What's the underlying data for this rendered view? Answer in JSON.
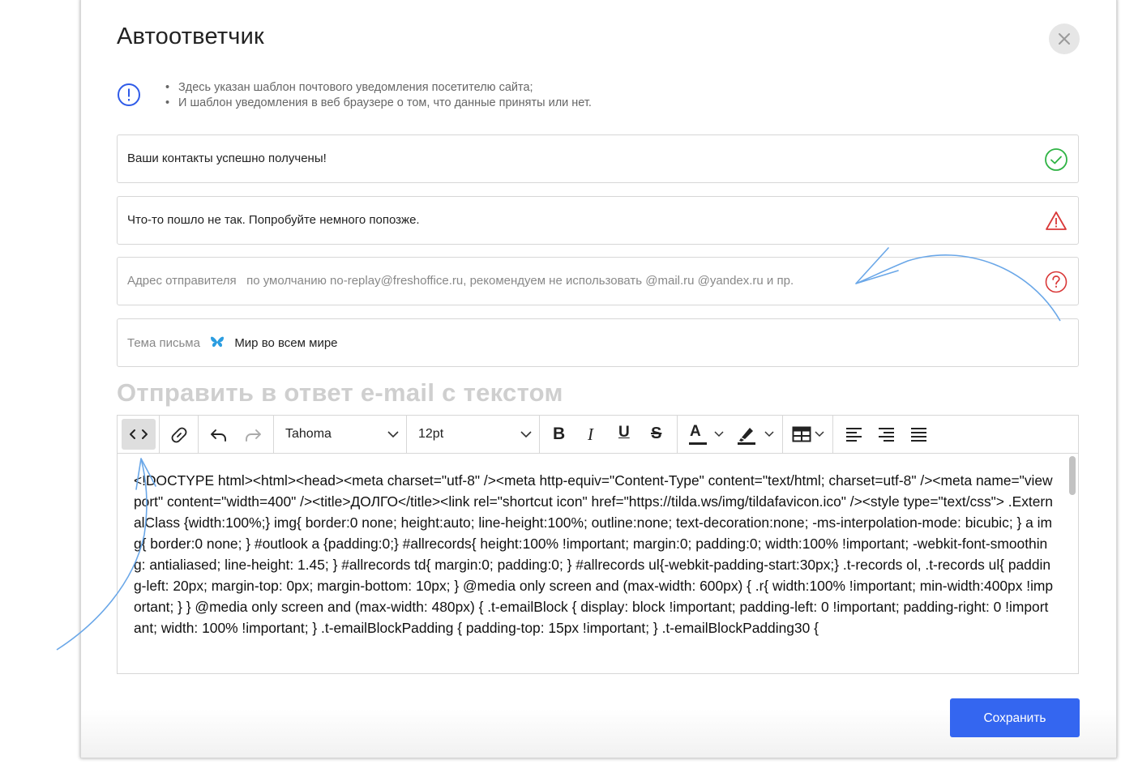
{
  "dialog": {
    "title": "Автоответчик",
    "info": [
      "Здесь указан шаблон почтового уведомления посетителю сайта;",
      "И шаблон уведомления в веб браузере о том, что данные приняты или нет."
    ]
  },
  "fields": {
    "success_message": "Ваши контакты успешно получены!",
    "error_message": "Что-то пошло не так. Попробуйте немного попозже.",
    "sender_label": "Адрес отправителя",
    "sender_placeholder": "по умолчанию no-replay@freshoffice.ru, рекомендуем не использовать @mail.ru @yandex.ru и пр.",
    "subject_label": "Тема письма",
    "subject_value": "Мир во всем мире"
  },
  "section_title": "Отправить в ответ e-mail с текстом",
  "toolbar": {
    "font_family": "Tahoma",
    "font_size": "12pt",
    "bold": "B",
    "italic": "I",
    "underline": "U",
    "strike": "S",
    "text_color": "A"
  },
  "editor_content": "<!DOCTYPE html><html><head><meta charset=\"utf-8\" /><meta http-equiv=\"Content-Type\" content=\"text/html; charset=utf-8\" /><meta name=\"viewport\" content=\"width=400\" /><title>ДОЛГО</title><link rel=\"shortcut icon\" href=\"https://tilda.ws/img/tildafavicon.ico\" /><style type=\"text/css\">      .ExternalClass {width:100%;}       img{ border:0 none; height:auto; line-height:100%; outline:none; text-decoration:none; -ms-interpolation-mode: bicubic;  }       a img{ border:0 none;        }       #outlook a {padding:0;}       #allrecords{ height:100% !important; margin:0; padding:0; width:100% !important; -webkit-font-smoothing: antialiased; line-height: 1.45;     }       #allrecords td{ margin:0; padding:0;     }       #allrecords ul{-webkit-padding-start:30px;}   .t-records ol,       .t-records ul{      padding-left: 20px;      margin-top: 0px;         margin-bottom: 10px;        }       @media only screen and (max-width: 600px) { .r{ width:100% !important;      min-width:400px !important;     }       }       @media only screen and (max-width: 480px) { .t-emailBlock { display: block !important; padding-left: 0 !important; padding-right: 0 !important; width: 100% !important; } .t-emailBlockPadding { padding-top: 15px !important; } .t-emailBlockPadding30 {",
  "save_button": "Сохранить",
  "colors": {
    "accent": "#3466f0",
    "success": "#2fb344",
    "warning": "#d93838",
    "info": "#2f5be8",
    "annotation": "#6aa7e8"
  }
}
